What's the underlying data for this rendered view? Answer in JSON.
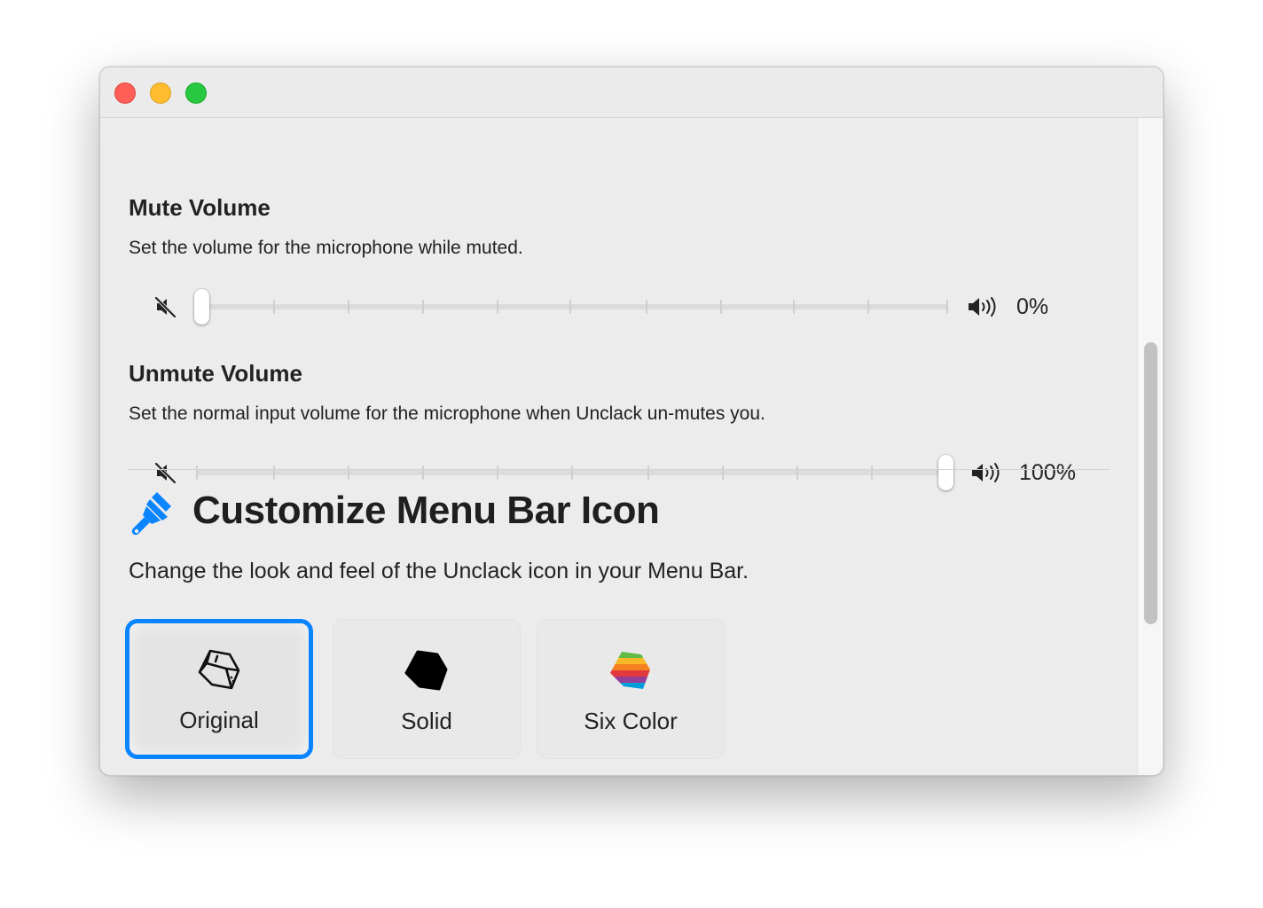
{
  "window": {
    "controls": [
      "close",
      "minimize",
      "zoom"
    ]
  },
  "mute_section": {
    "title": "Mute Volume",
    "description": "Set the volume for the microphone while muted.",
    "value": 0,
    "value_label": "0%"
  },
  "unmute_section": {
    "title": "Unmute Volume",
    "description": "Set the normal input volume for the microphone when Unclack un-mutes you.",
    "value": 100,
    "value_label": "100%"
  },
  "customize": {
    "icon": "paintbrush-icon",
    "title": "Customize Menu Bar Icon",
    "description": "Change the look and feel of the Unclack icon in your Menu Bar.",
    "options": [
      {
        "label": "Original",
        "icon": "keycap-outline-icon",
        "selected": true
      },
      {
        "label": "Solid",
        "icon": "keycap-solid-icon",
        "selected": false
      },
      {
        "label": "Six Color",
        "icon": "keycap-rainbow-icon",
        "selected": false
      }
    ]
  },
  "colors": {
    "accent": "#0a84ff",
    "close": "#ff5f57",
    "minimize": "#febc2e",
    "zoom": "#28c840"
  }
}
